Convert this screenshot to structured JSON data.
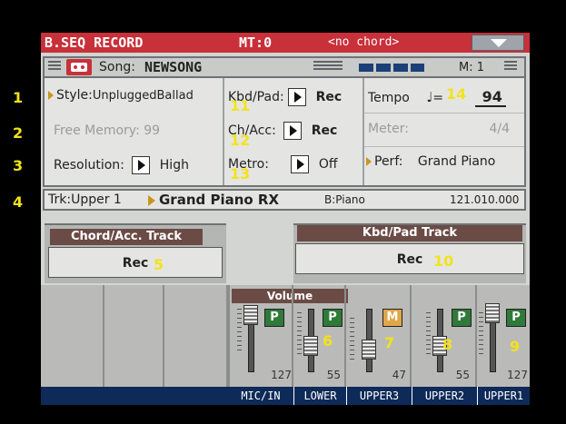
{
  "titlebar": {
    "mode": "B.SEQ RECORD",
    "meter_track": "MT:0",
    "chord": "<no chord>"
  },
  "song": {
    "prefix": "Song:",
    "name": "NEWSONG",
    "measure": "M: 1"
  },
  "rows": {
    "style_label": "Style:",
    "style_value": "UnpluggedBallad",
    "free_memory_label": "Free Memory:",
    "free_memory_value": "99",
    "resolution_label": "Resolution:",
    "resolution_value": "High",
    "kbdpad_label": "Kbd/Pad:",
    "kbdpad_value": "Rec",
    "chacc_label": "Ch/Acc:",
    "chacc_value": "Rec",
    "metro_label": "Metro:",
    "metro_value": "Off",
    "tempo_label": "Tempo",
    "tempo_eq": "=",
    "tempo_value": "94",
    "meter_label": "Meter:",
    "meter_value": "4/4",
    "perf_label": "Perf:",
    "perf_value": "Grand Piano"
  },
  "trackbar": {
    "track": "Trk:Upper 1",
    "sound": "Grand Piano RX",
    "bank": "B:Piano",
    "position": "121.010.000"
  },
  "panels": {
    "chord_title": "Chord/Acc. Track",
    "chord_value": "Rec",
    "kbd_title": "Kbd/Pad Track",
    "kbd_value": "Rec"
  },
  "mixer": {
    "volume_label": "Volume",
    "channels": [
      {
        "name": "MIC/IN",
        "value": "127",
        "button": "P"
      },
      {
        "name": "LOWER",
        "value": "55",
        "button": "P"
      },
      {
        "name": "UPPER3",
        "value": "47",
        "button": "M"
      },
      {
        "name": "UPPER2",
        "value": "55",
        "button": "P"
      },
      {
        "name": "UPPER1",
        "value": "127",
        "button": "P"
      }
    ]
  },
  "annotations": {
    "n1": "1",
    "n2": "2",
    "n3": "3",
    "n4": "4",
    "n5": "5",
    "n6": "6",
    "n7": "7",
    "n8": "8",
    "n9": "9",
    "n10": "10",
    "n11": "11",
    "n12": "12",
    "n13": "13",
    "n14": "14"
  },
  "colors": {
    "title_red": "#c8303a",
    "panel_brown": "#6b4b45",
    "play_green": "#2f7a3a",
    "mute_orange": "#e0a64a",
    "annotation_yellow": "#f4e21b",
    "channel_bar_blue": "#0e2a58"
  },
  "icons": {
    "song": "song-cassette-icon",
    "menu": "dropdown-triangle-icon",
    "tempo": "quarter-note-icon"
  }
}
